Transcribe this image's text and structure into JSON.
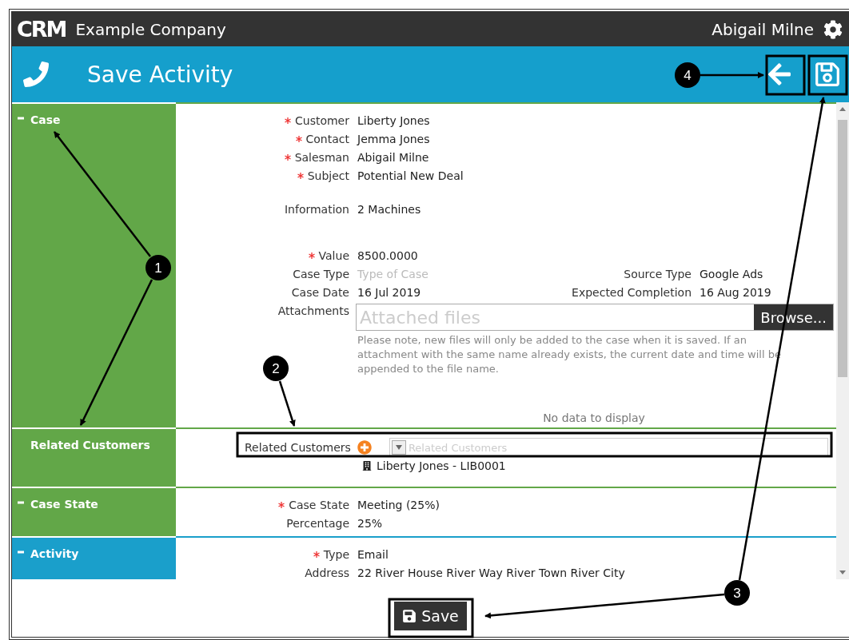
{
  "header": {
    "logo": "CRM",
    "company": "Example Company",
    "user": "Abigail Milne"
  },
  "toolbar": {
    "title": "Save Activity"
  },
  "sections": [
    {
      "kind": "form",
      "title": "Case",
      "expanded": true,
      "color": "#62a748",
      "rows": [
        {
          "kind": "field",
          "label": "Customer",
          "value": "Liberty Jones",
          "required": true
        },
        {
          "kind": "field",
          "label": "Contact",
          "value": "Jemma Jones",
          "required": true
        },
        {
          "kind": "field",
          "label": "Salesman",
          "value": "Abigail Milne",
          "required": true
        },
        {
          "kind": "field",
          "label": "Subject",
          "value": "Potential New Deal",
          "required": true
        },
        {
          "kind": "memo",
          "label": "Information",
          "value": "2 Machines",
          "required": false
        },
        {
          "kind": "field",
          "label": "Value",
          "value": "8500.0000",
          "required": true
        },
        {
          "kind": "field",
          "label": "Case Type",
          "placeholder": "Type of Case",
          "required": false,
          "side": {
            "label": "Source Type",
            "value": "Google Ads"
          }
        },
        {
          "kind": "field",
          "label": "Case Date",
          "value": "16 Jul 2019",
          "required": false,
          "side": {
            "label": "Expected Completion",
            "value": "16 Aug 2019"
          }
        },
        {
          "kind": "file",
          "label": "Attachments",
          "placeholder": "Attached files",
          "button": "Browse...",
          "note": "Please note, new files will only be added to the case when it is saved. If an attachment with the same name already exists, the current date and time will be appended to the file name.",
          "required": false
        }
      ],
      "empty_message": "No data to display"
    },
    {
      "kind": "related",
      "title": "Related Customers",
      "color": "#62a748",
      "label": "Related Customers",
      "placeholder": "Related Customers",
      "items": [
        "Liberty Jones - LIB0001"
      ]
    },
    {
      "kind": "form",
      "title": "Case State",
      "expanded": true,
      "color": "#62a748",
      "rows": [
        {
          "kind": "field",
          "label": "Case State",
          "value": "Meeting (25%)",
          "required": true
        },
        {
          "kind": "field",
          "label": "Percentage",
          "value": "25%",
          "required": false
        }
      ]
    },
    {
      "kind": "form",
      "title": "Activity",
      "expanded": true,
      "color": "#1a9fcb",
      "rows": [
        {
          "kind": "field",
          "label": "Type",
          "value": "Email",
          "required": true
        },
        {
          "kind": "field",
          "label": "Address",
          "value": "22 River House River Way River Town River City",
          "required": false
        }
      ]
    }
  ],
  "footer": {
    "save_button": "Save"
  },
  "annotations": [
    {
      "number": "1"
    },
    {
      "number": "2"
    },
    {
      "number": "3"
    },
    {
      "number": "4"
    }
  ]
}
